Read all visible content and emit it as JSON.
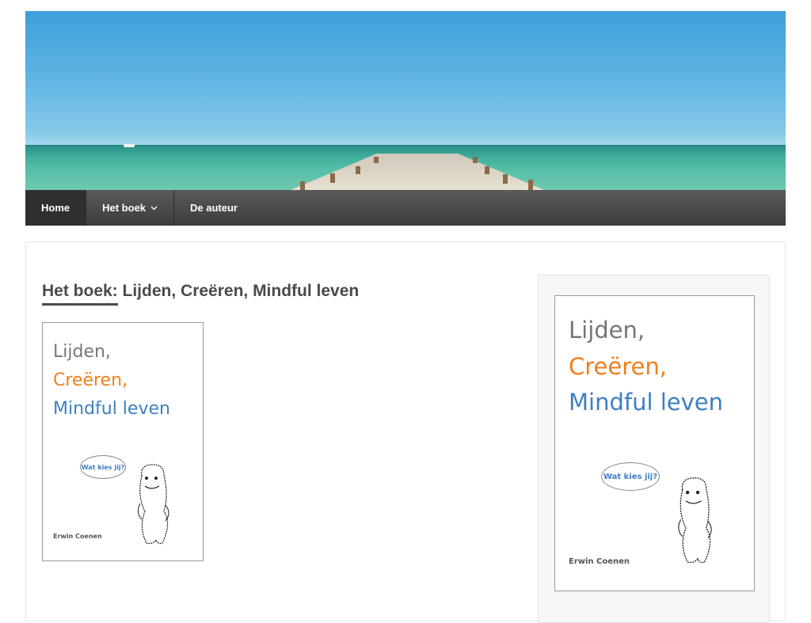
{
  "nav": {
    "items": [
      {
        "label": "Home",
        "active": true
      },
      {
        "label": "Het boek",
        "has_dropdown": true
      },
      {
        "label": "De auteur"
      }
    ]
  },
  "page": {
    "title_prefix": "Het boek:",
    "title_rest": " Lijden, Creëren, Mindful leven"
  },
  "book_cover": {
    "line1": "Lijden,",
    "line2": "Creëren,",
    "line3": "Mindful leven",
    "speech": "Wat kies jij?",
    "author": "Erwin Coenen"
  },
  "colors": {
    "nav_background": "#3c3c3c",
    "title_gray": "#767676",
    "title_orange": "#f07f1c",
    "title_blue": "#3d7fc2"
  }
}
